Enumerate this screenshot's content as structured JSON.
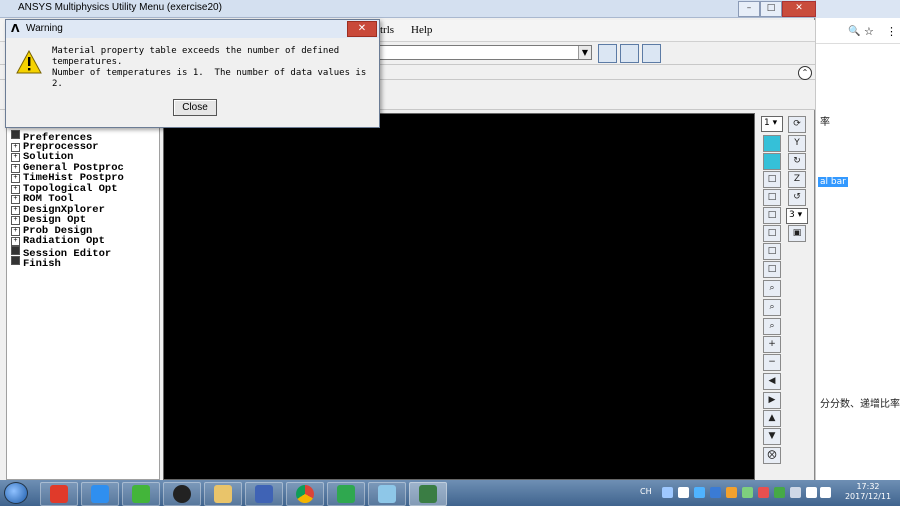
{
  "app": {
    "title": "ANSYS Multiphysics Utility Menu (exercise20)"
  },
  "menubar": {
    "items": [
      "trls",
      "Help"
    ]
  },
  "tree": {
    "items": [
      {
        "label": "Preferences",
        "type": "leaf"
      },
      {
        "label": "Preprocessor",
        "type": "expand"
      },
      {
        "label": "Solution",
        "type": "expand"
      },
      {
        "label": "General Postproc",
        "type": "expand"
      },
      {
        "label": "TimeHist Postpro",
        "type": "expand"
      },
      {
        "label": "Topological Opt",
        "type": "expand"
      },
      {
        "label": "ROM Tool",
        "type": "expand"
      },
      {
        "label": "DesignXplorer",
        "type": "expand"
      },
      {
        "label": "Design Opt",
        "type": "expand"
      },
      {
        "label": "Prob Design",
        "type": "expand"
      },
      {
        "label": "Radiation Opt",
        "type": "expand"
      },
      {
        "label": "Session Editor",
        "type": "leaf"
      },
      {
        "label": "Finish",
        "type": "leaf"
      }
    ]
  },
  "right_toolbar": {
    "window_number": "1",
    "view_number": "3"
  },
  "dialog": {
    "title": "Warning",
    "message": "Material property table exceeds the number of defined\ntemperatures.\nNumber of temperatures is 1.  The number of data values is\n2.",
    "close_button": "Close"
  },
  "browser": {
    "highlight_text": "al bar",
    "cn_text": "分分数、递增比率"
  },
  "taskbar": {
    "clock_time": "17:32",
    "clock_date": "2017/12/11",
    "tray_lang": "CH"
  },
  "colors": {
    "graphics_bg": "#000000",
    "dialog_title_bg": "#dfe8f5",
    "close_red": "#c9493a"
  }
}
